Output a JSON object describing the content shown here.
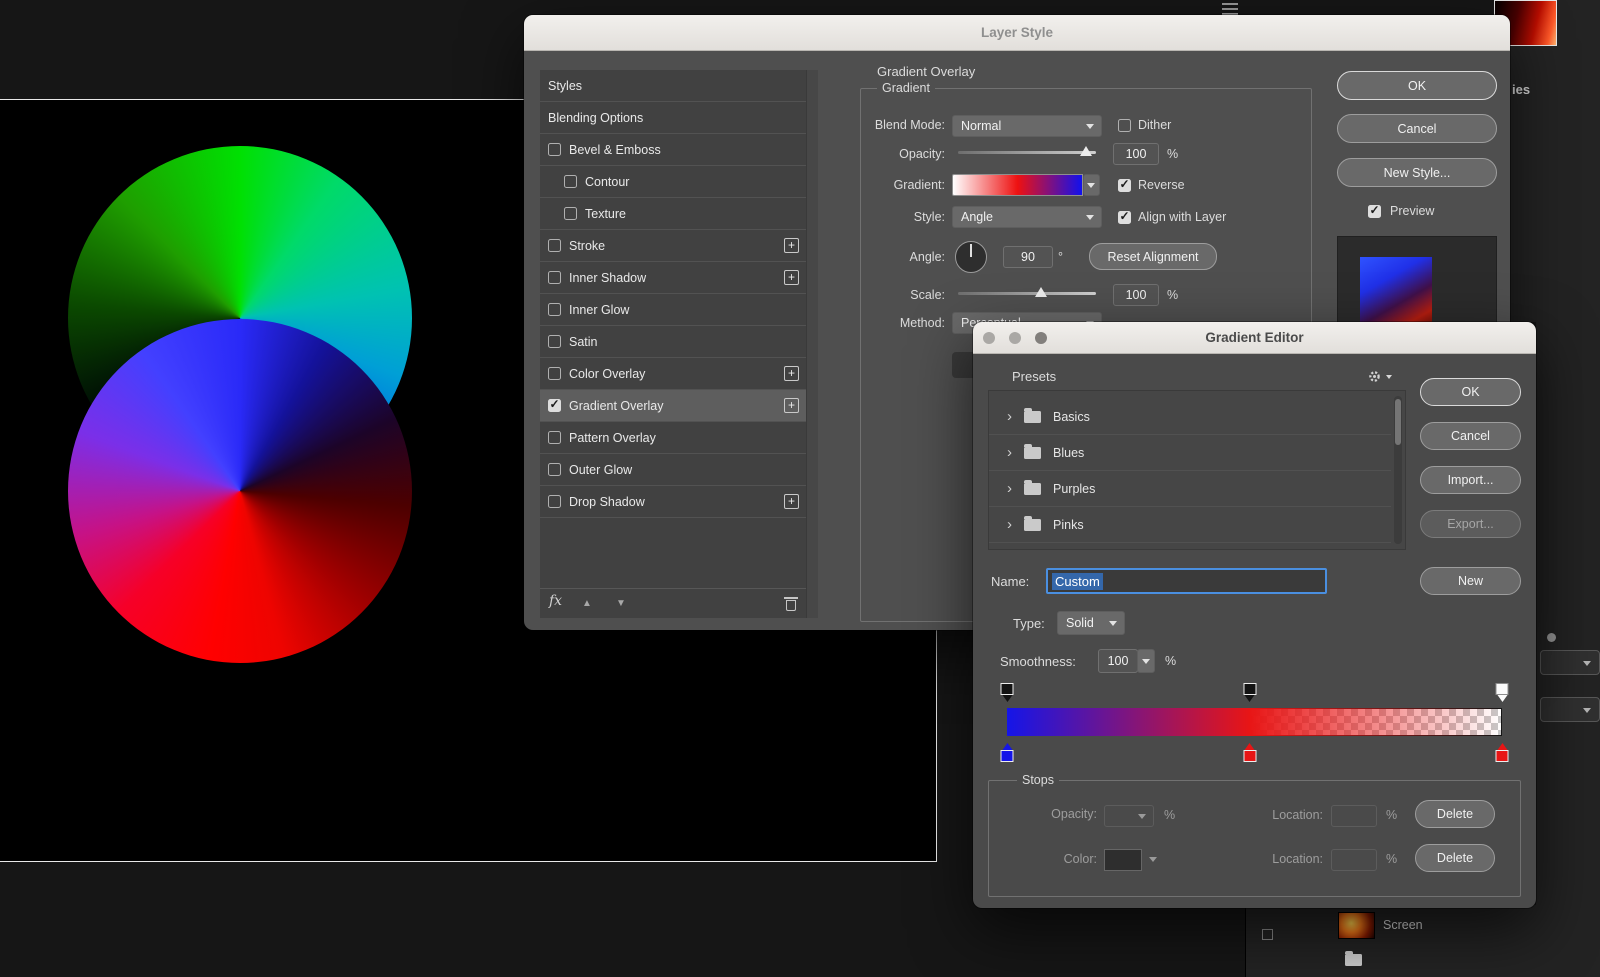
{
  "icons": {
    "check": "✓",
    "plus": "+",
    "chevron_right": "›",
    "arrow_up": "▲",
    "arrow_down": "▼"
  },
  "layer_style": {
    "title": "Layer Style",
    "styles_panel": {
      "items": [
        {
          "label": "Styles",
          "checkbox": false,
          "checked": false
        },
        {
          "label": "Blending Options",
          "checkbox": false,
          "checked": false
        },
        {
          "label": "Bevel & Emboss",
          "checkbox": true,
          "checked": false
        },
        {
          "label": "Contour",
          "checkbox": true,
          "checked": false,
          "indented": true
        },
        {
          "label": "Texture",
          "checkbox": true,
          "checked": false,
          "indented": true
        },
        {
          "label": "Stroke",
          "checkbox": true,
          "checked": false,
          "has_add": true
        },
        {
          "label": "Inner Shadow",
          "checkbox": true,
          "checked": false,
          "has_add": true
        },
        {
          "label": "Inner Glow",
          "checkbox": true,
          "checked": false
        },
        {
          "label": "Satin",
          "checkbox": true,
          "checked": false
        },
        {
          "label": "Color Overlay",
          "checkbox": true,
          "checked": false,
          "has_add": true
        },
        {
          "label": "Gradient Overlay",
          "checkbox": true,
          "checked": true,
          "has_add": true,
          "selected": true
        },
        {
          "label": "Pattern Overlay",
          "checkbox": true,
          "checked": false
        },
        {
          "label": "Outer Glow",
          "checkbox": true,
          "checked": false
        },
        {
          "label": "Drop Shadow",
          "checkbox": true,
          "checked": false,
          "has_add": true
        }
      ],
      "fx_label": "fx"
    },
    "panel_title": "Gradient Overlay",
    "group_label": "Gradient",
    "rows": {
      "blend_mode": {
        "label": "Blend Mode:",
        "value": "Normal"
      },
      "dither": {
        "label": "Dither",
        "checked": false
      },
      "opacity": {
        "label": "Opacity:",
        "value": "100",
        "unit": "%"
      },
      "gradient": {
        "label": "Gradient:",
        "swatch_colors": [
          "#ffffff",
          "#ee1111",
          "#1111ee"
        ]
      },
      "reverse": {
        "label": "Reverse",
        "checked": true
      },
      "style": {
        "label": "Style:",
        "value": "Angle"
      },
      "align": {
        "label": "Align with Layer",
        "checked": true
      },
      "angle": {
        "label": "Angle:",
        "value": "90",
        "unit": "°"
      },
      "reset_alignment_label": "Reset Alignment",
      "scale": {
        "label": "Scale:",
        "value": "100",
        "unit": "%"
      },
      "method": {
        "label": "Method:",
        "value": "Perceptual"
      }
    },
    "buttons": {
      "ok": "OK",
      "cancel": "Cancel",
      "new_style": "New Style...",
      "preview": {
        "label": "Preview",
        "checked": true
      }
    }
  },
  "gradient_editor": {
    "title": "Gradient Editor",
    "presets": {
      "title": "Presets",
      "folders": [
        {
          "label": "Basics"
        },
        {
          "label": "Blues"
        },
        {
          "label": "Purples"
        },
        {
          "label": "Pinks"
        }
      ]
    },
    "buttons": {
      "ok": "OK",
      "cancel": "Cancel",
      "import": "Import...",
      "export": "Export...",
      "new": "New"
    },
    "name": {
      "label": "Name:",
      "value": "Custom"
    },
    "type": {
      "label": "Type:",
      "value": "Solid"
    },
    "smoothness": {
      "label": "Smoothness:",
      "value": "100",
      "unit": "%"
    },
    "gradient_bar": {
      "opacity_stops": [
        {
          "location_pct": 0,
          "opacity_pct": 100
        },
        {
          "location_pct": 49,
          "opacity_pct": 100
        },
        {
          "location_pct": 100,
          "opacity_pct": 0
        }
      ],
      "color_stops": [
        {
          "location_pct": 0,
          "color": "#1515e8"
        },
        {
          "location_pct": 49,
          "color": "#e81515"
        },
        {
          "location_pct": 100,
          "color": "#e81515"
        }
      ]
    },
    "stops_section": {
      "title": "Stops",
      "opacity_row": {
        "opacity_label": "Opacity:",
        "opacity_unit": "%",
        "location_label": "Location:",
        "location_unit": "%",
        "delete_label": "Delete"
      },
      "color_row": {
        "color_label": "Color:",
        "location_label": "Location:",
        "location_unit": "%",
        "delete_label": "Delete"
      }
    },
    "colors": {
      "focus_blue": "#4a8fe0",
      "selection_blue": "#3467aa"
    }
  },
  "background_panels": {
    "properties_title_fragment": "ies",
    "layers": {
      "blend_mode_value": "Screen"
    }
  }
}
